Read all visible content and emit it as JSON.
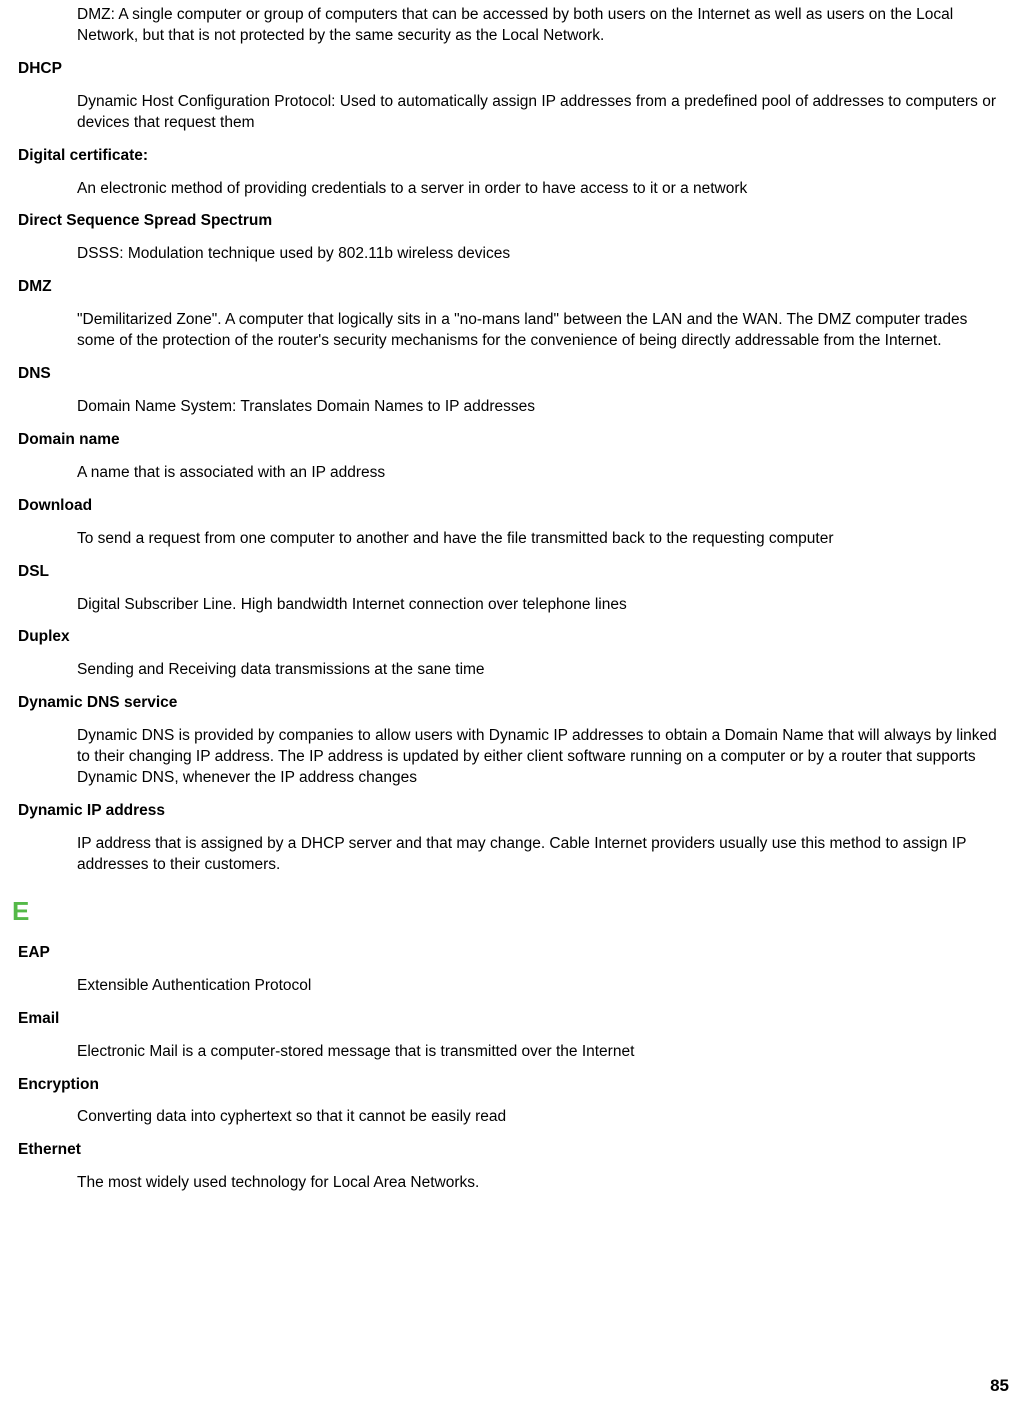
{
  "orphan_def": "DMZ: A single computer or group of computers that can be accessed by both users on the Internet as well as users on the Local Network, but that is not protected by the same security as the Local Network.",
  "entries": [
    {
      "term": "DHCP",
      "def": "Dynamic Host Configuration Protocol: Used to automatically assign IP addresses from a predefined pool of addresses to computers or devices that request them"
    },
    {
      "term": "Digital certificate:",
      "def": "An electronic method of providing credentials to a server in order to have access to it or a network"
    },
    {
      "term": "Direct Sequence Spread Spectrum",
      "def": "DSSS: Modulation technique used by 802.11b wireless devices"
    },
    {
      "term": "DMZ",
      "def": "\"Demilitarized Zone\". A computer that logically sits in a \"no-mans land\" between the LAN and the WAN. The DMZ computer trades some of the protection of the router's security mechanisms for the convenience of being directly addressable from the Internet."
    },
    {
      "term": "DNS",
      "def": "Domain Name System: Translates Domain Names to IP addresses"
    },
    {
      "term": "Domain name",
      "def": "A name that is associated with an IP address"
    },
    {
      "term": "Download",
      "def": "To send a request from one computer to another and have the file transmitted back to the requesting computer"
    },
    {
      "term": "DSL",
      "def": "Digital Subscriber Line. High bandwidth Internet connection over telephone lines"
    },
    {
      "term": "Duplex",
      "def": "Sending and Receiving data transmissions at the sane time"
    },
    {
      "term": "Dynamic DNS service",
      "def": "Dynamic DNS is provided by companies to allow users with Dynamic IP addresses to obtain a Domain Name that will always by linked to their changing IP address. The IP address is updated by either client software running on a computer or by a router that supports Dynamic DNS, whenever the IP address changes"
    },
    {
      "term": "Dynamic IP address",
      "def": "IP address that is assigned by a DHCP server and that may change. Cable Internet providers usually use this method to assign IP addresses to their customers."
    }
  ],
  "section_letter": "E",
  "entries2": [
    {
      "term": "EAP",
      "def": "Extensible Authentication Protocol"
    },
    {
      "term": "Email",
      "def": "Electronic Mail is a computer-stored message that is transmitted over the Internet"
    },
    {
      "term": "Encryption",
      "def": "Converting data into cyphertext so that it cannot be easily read"
    },
    {
      "term": "Ethernet",
      "def": "The most widely used technology for Local Area Networks."
    }
  ],
  "page_number": "85"
}
